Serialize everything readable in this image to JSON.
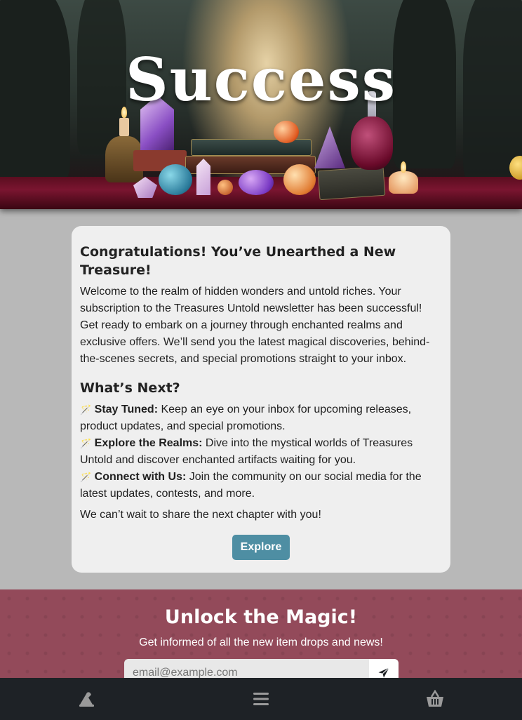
{
  "hero": {
    "title": "Success"
  },
  "card": {
    "heading": "Congratulations! You’ve Unearthed a New Treasure!",
    "intro": "Welcome to the realm of hidden wonders and untold riches. Your subscription to the Treasures Untold newsletter has been successful! Get ready to embark on a journey through enchanted realms and exclusive offers. We’ll send you the latest magical discoveries, behind-the-scenes secrets, and special promotions straight to your inbox.",
    "next_heading": "What’s Next?",
    "items": [
      {
        "label": "Stay Tuned:",
        "text": " Keep an eye on your inbox for upcoming releases, product updates, and special promotions."
      },
      {
        "label": "Explore the Realms:",
        "text": " Dive into the mystical worlds of Treasures Untold and discover enchanted artifacts waiting for you."
      },
      {
        "label": "Connect with Us:",
        "text": " Join the community on our social media for the latest updates, contests, and more."
      }
    ],
    "closing": "We can’t wait to share the next chapter with you!",
    "explore_label": "Explore"
  },
  "newsletter": {
    "title": "Unlock the Magic!",
    "subtitle": "Get informed of all the new item drops and news!",
    "placeholder": "email@example.com",
    "send_icon": "paper-plane-icon"
  },
  "nav": {
    "items": [
      {
        "icon": "wizard-hat-icon"
      },
      {
        "icon": "menu-icon"
      },
      {
        "icon": "basket-icon"
      }
    ]
  },
  "colors": {
    "accent": "#4e8ea3",
    "newsletter_bg": "#934a5a",
    "nav_bg": "#1e2226",
    "page_bg": "#b8b8b8"
  }
}
